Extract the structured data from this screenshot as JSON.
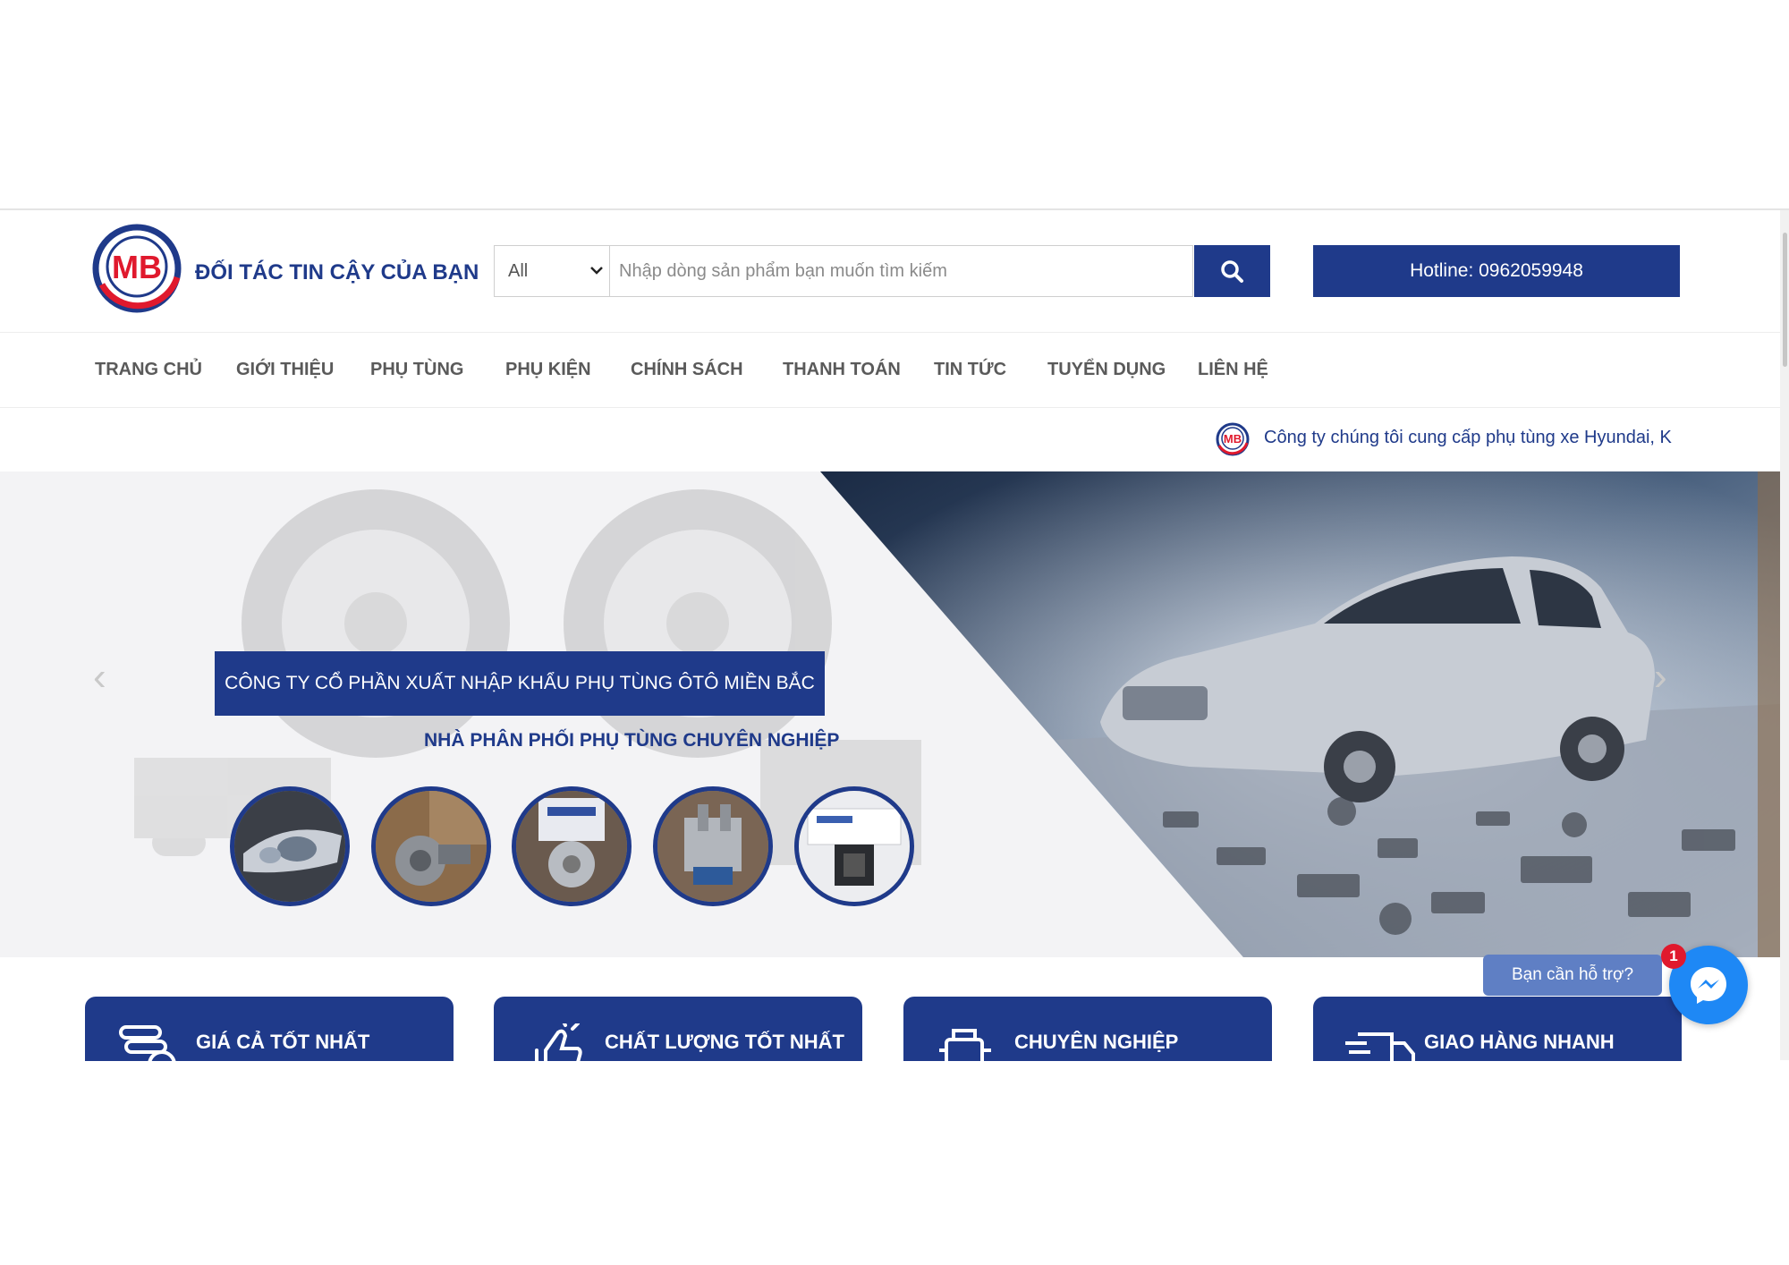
{
  "header": {
    "logo_text": "MB",
    "tagline": "ĐỐI TÁC TIN CẬY CỦA BẠN",
    "search": {
      "category": "All",
      "placeholder": "Nhập dòng sản phẩm bạn muốn tìm kiếm"
    },
    "hotline": "Hotline: 0962059948"
  },
  "nav": {
    "items": [
      "TRANG CHỦ",
      "GIỚI THIỆU",
      "PHỤ TÙNG",
      "PHỤ KIỆN",
      "CHÍNH SÁCH",
      "THANH TOÁN",
      "TIN TỨC",
      "TUYỂN DỤNG",
      "LIÊN HỆ"
    ]
  },
  "ticker": {
    "text": "Công ty chúng tôi cung cấp phụ tùng xe Hyundai, K"
  },
  "banner": {
    "headline": "CÔNG TY CỔ PHẦN XUẤT NHẬP KHẨU PHỤ TÙNG ÔTÔ MIỀN BẮC",
    "subline": "NHÀ PHÂN PHỐI PHỤ TÙNG CHUYÊN NGHIỆP",
    "prev": "‹",
    "next": "›"
  },
  "features": [
    {
      "label": "GIÁ CẢ TỐT NHẤT",
      "icon": "coins-icon"
    },
    {
      "label": "CHẤT LƯỢNG TỐT NHẤT",
      "icon": "thumbs-up-icon"
    },
    {
      "label": "CHUYÊN NGHIỆP",
      "icon": "engine-icon"
    },
    {
      "label": "GIAO HÀNG NHANH",
      "icon": "truck-icon"
    }
  ],
  "support": {
    "label": "Bạn cần hỗ trợ?",
    "badge": "1"
  },
  "colors": {
    "brand": "#1f3a8a",
    "accent_red": "#e0192d",
    "messenger": "#1e88f5"
  }
}
